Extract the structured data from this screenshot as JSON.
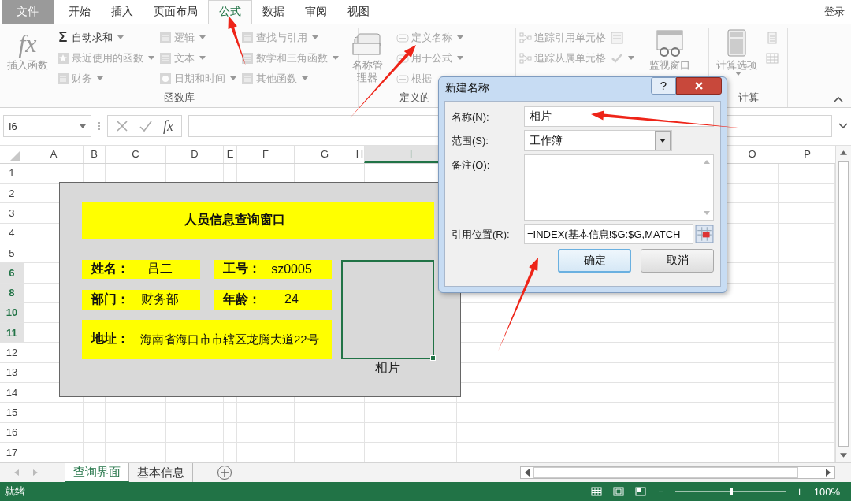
{
  "tabs": [
    {
      "label": "文件",
      "kind": "file",
      "selected": false
    },
    {
      "label": "开始",
      "kind": "tab",
      "selected": false
    },
    {
      "label": "插入",
      "kind": "tab",
      "selected": false
    },
    {
      "label": "页面布局",
      "kind": "tab",
      "selected": false
    },
    {
      "label": "公式",
      "kind": "tab",
      "selected": true
    },
    {
      "label": "数据",
      "kind": "tab",
      "selected": false
    },
    {
      "label": "审阅",
      "kind": "tab",
      "selected": false
    },
    {
      "label": "视图",
      "kind": "tab",
      "selected": false
    }
  ],
  "account": "登录",
  "ribbon": {
    "groups": [
      {
        "label": "函数库",
        "large": [
          {
            "label": "插入函数",
            "symbol": "fx",
            "caret": false,
            "disabled": true
          }
        ],
        "columns": [
          [
            {
              "label": "自动求和",
              "symbol": "Σ",
              "caret": true,
              "disabled": false
            },
            {
              "label": "最近使用的函数",
              "caret": true,
              "disabled": true
            },
            {
              "label": "财务",
              "caret": true,
              "disabled": true
            }
          ],
          [
            {
              "label": "逻辑",
              "caret": true,
              "disabled": true
            },
            {
              "label": "文本",
              "caret": true,
              "disabled": true
            },
            {
              "label": "日期和时间",
              "caret": true,
              "disabled": true
            }
          ],
          [
            {
              "label": "查找与引用",
              "caret": true,
              "disabled": true
            },
            {
              "label": "数学和三角函数",
              "caret": true,
              "disabled": true
            },
            {
              "label": "其他函数",
              "caret": true,
              "disabled": true
            }
          ]
        ]
      },
      {
        "label": "定义的",
        "large": [
          {
            "label": "名称管理器",
            "caret": false,
            "disabled": true
          }
        ],
        "columns": [
          [
            {
              "label": "定义名称",
              "caret": true,
              "disabled": true
            },
            {
              "label": "用于公式",
              "caret": true,
              "disabled": true
            },
            {
              "label": "根据",
              "caret": false,
              "disabled": true
            }
          ]
        ]
      },
      {
        "columns": [
          [
            {
              "label": "追踪引用单元格",
              "caret": false,
              "disabled": true
            },
            {
              "label": "追踪从属单元格",
              "caret": false,
              "disabled": true
            }
          ],
          [
            {
              "caret": false,
              "disabled": true
            },
            {
              "caret": true,
              "disabled": true
            }
          ]
        ],
        "large": [
          {
            "label": "监视窗口",
            "caret": false,
            "disabled": true
          }
        ]
      },
      {
        "label": "计算",
        "large": [
          {
            "label": "计算选项",
            "caret": true,
            "disabled": true
          }
        ],
        "columns": [
          [
            {
              "caret": false,
              "disabled": true
            },
            {
              "caret": false,
              "disabled": true
            }
          ]
        ]
      }
    ]
  },
  "formula_bar": {
    "name_box": "I6",
    "symbol": "fx"
  },
  "columns": [
    {
      "label": "A",
      "selected": false
    },
    {
      "label": "B",
      "selected": false
    },
    {
      "label": "C",
      "selected": false
    },
    {
      "label": "D",
      "selected": false
    },
    {
      "label": "E",
      "selected": false
    },
    {
      "label": "F",
      "selected": false
    },
    {
      "label": "G",
      "selected": false
    },
    {
      "label": "H",
      "selected": false
    },
    {
      "label": "I",
      "selected": true
    },
    {
      "label": "O",
      "selected": false
    },
    {
      "label": "P",
      "selected": false
    }
  ],
  "rows": [
    {
      "label": "1",
      "selected": false
    },
    {
      "label": "2",
      "selected": false
    },
    {
      "label": "3",
      "selected": false
    },
    {
      "label": "4",
      "selected": false
    },
    {
      "label": "5",
      "selected": false
    },
    {
      "label": "6",
      "selected": true
    },
    {
      "label": "8",
      "selected": true
    },
    {
      "label": "10",
      "selected": true
    },
    {
      "label": "11",
      "selected": true
    },
    {
      "label": "12",
      "selected": false
    },
    {
      "label": "13",
      "selected": false
    },
    {
      "label": "14",
      "selected": false
    },
    {
      "label": "15",
      "selected": false
    },
    {
      "label": "16",
      "selected": false
    },
    {
      "label": "17",
      "selected": false
    }
  ],
  "info_panel": {
    "title": "人员信息查询窗口",
    "fields": [
      {
        "label": "姓名：",
        "value": "吕二"
      },
      {
        "label": "工号：",
        "value": "sz0005"
      },
      {
        "label": "部门：",
        "value": "财务部"
      },
      {
        "label": "年龄：",
        "value": "24"
      }
    ],
    "address": {
      "label": "地址：",
      "value": "海南省海口市市辖区龙腾大道22号"
    },
    "photo_label": "相片"
  },
  "dialog": {
    "title": "新建名称",
    "help": "?",
    "fields": [
      {
        "label": "名称(N):",
        "kind": "text",
        "value": "相片"
      },
      {
        "label": "范围(S):",
        "kind": "select",
        "value": "工作簿"
      },
      {
        "label": "备注(O):",
        "kind": "textarea"
      },
      {
        "label": "引用位置(R):",
        "kind": "ref",
        "value": "=INDEX(基本信息!$G:$G,MATCH"
      }
    ],
    "buttons": [
      {
        "label": "确定",
        "default": true
      },
      {
        "label": "取消",
        "default": false
      }
    ]
  },
  "sheet_tabs": [
    {
      "label": "查询界面",
      "selected": true
    },
    {
      "label": "基本信息",
      "selected": false
    }
  ],
  "status_bar": {
    "text": "就绪",
    "zoom_out": "−",
    "zoom_in": "+",
    "zoom": "100%",
    "level": 0.5
  }
}
